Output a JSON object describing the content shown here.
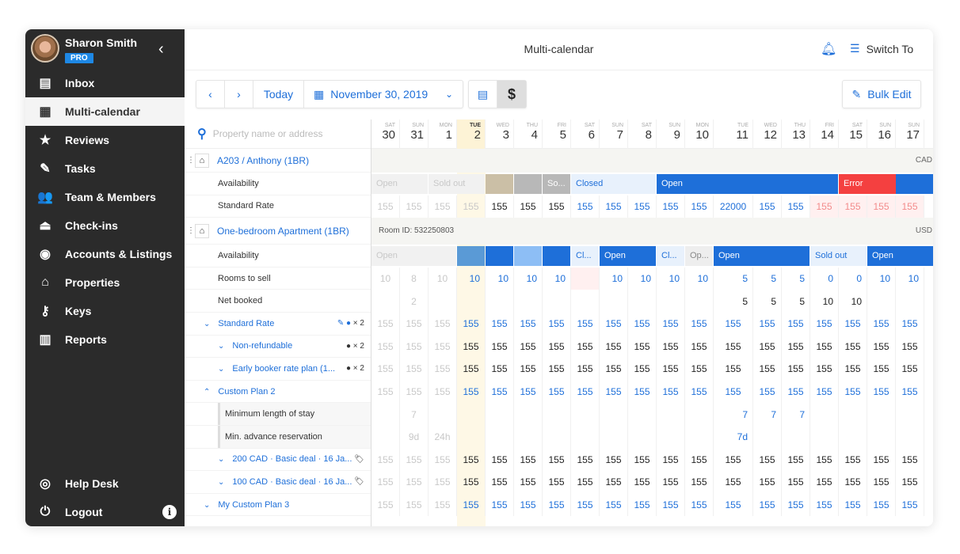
{
  "profile": {
    "name": "Sharon Smith",
    "badge": "PRO",
    "collapse_icon": "chevron-left-icon"
  },
  "sidebar": {
    "items": [
      {
        "label": "Inbox",
        "icon": "inbox-icon",
        "active": false
      },
      {
        "label": "Multi-calendar",
        "icon": "calendar-icon",
        "active": true
      },
      {
        "label": "Reviews",
        "icon": "star-icon",
        "active": false
      },
      {
        "label": "Tasks",
        "icon": "tasks-icon",
        "active": false
      },
      {
        "label": "Team & Members",
        "icon": "team-icon",
        "active": false
      },
      {
        "label": "Check-ins",
        "icon": "bell-desk-icon",
        "active": false
      },
      {
        "label": "Accounts & Listings",
        "icon": "account-icon",
        "active": false
      },
      {
        "label": "Properties",
        "icon": "home-icon",
        "active": false
      },
      {
        "label": "Keys",
        "icon": "key-icon",
        "active": false
      },
      {
        "label": "Reports",
        "icon": "reports-icon",
        "active": false
      }
    ],
    "bottom": [
      {
        "label": "Help Desk",
        "icon": "lifebuoy-icon"
      },
      {
        "label": "Logout",
        "icon": "power-icon"
      }
    ]
  },
  "header": {
    "title": "Multi-calendar",
    "switch_to": "Switch To"
  },
  "toolbar": {
    "prev": "‹",
    "next": "›",
    "today": "Today",
    "date": "November 30, 2019",
    "dropdown": "⌄",
    "view_rates": "$",
    "bulk_edit": "Bulk Edit"
  },
  "search": {
    "placeholder": "Property name or address"
  },
  "colors": {
    "accent": "#1e6fd9",
    "sidebar_bg": "#2b2b2b",
    "badge": "#1e88e5",
    "error": "#f44040",
    "open": "#1e6fd9"
  },
  "dates": [
    {
      "dow": "SAT",
      "day": "30"
    },
    {
      "dow": "SUN",
      "day": "31"
    },
    {
      "dow": "MON",
      "day": "1"
    },
    {
      "dow": "TUE",
      "day": "2",
      "today": true
    },
    {
      "dow": "WED",
      "day": "3"
    },
    {
      "dow": "THU",
      "day": "4"
    },
    {
      "dow": "FRI",
      "day": "5"
    },
    {
      "dow": "SAT",
      "day": "6"
    },
    {
      "dow": "SUN",
      "day": "7"
    },
    {
      "dow": "SAT",
      "day": "8"
    },
    {
      "dow": "SUN",
      "day": "9"
    },
    {
      "dow": "MON",
      "day": "10"
    },
    {
      "dow": "TUE",
      "day": "11"
    },
    {
      "dow": "WED",
      "day": "12"
    },
    {
      "dow": "THU",
      "day": "13"
    },
    {
      "dow": "FRI",
      "day": "14"
    },
    {
      "dow": "SAT",
      "day": "15"
    },
    {
      "dow": "SUN",
      "day": "16"
    },
    {
      "dow": "SUN",
      "day": "17"
    }
  ],
  "properties": [
    {
      "name": "A203 / Anthony (1BR)",
      "currency": "CAD",
      "rows": {
        "availability_label": "Availability",
        "rate_label": "Standard Rate",
        "availability_bars": [
          {
            "label": "Open",
            "from": 0,
            "span": 2,
            "style": "faded"
          },
          {
            "label": "Sold out",
            "from": 2,
            "span": 2,
            "style": "faded"
          },
          {
            "label": "",
            "from": 4,
            "span": 1,
            "style": "tan"
          },
          {
            "label": "",
            "from": 5,
            "span": 1,
            "style": "gray"
          },
          {
            "label": "So...",
            "from": 6,
            "span": 1,
            "style": "gray"
          },
          {
            "label": "Closed",
            "from": 7,
            "span": 3,
            "style": "closed"
          },
          {
            "label": "Open",
            "from": 10,
            "span": 6,
            "style": "open"
          },
          {
            "label": "Error",
            "from": 16,
            "span": 4,
            "style": "error"
          },
          {
            "label": "",
            "from": 20,
            "span": 1,
            "style": "open"
          }
        ],
        "rates": [
          "155",
          "155",
          "155",
          "155",
          "155",
          "155",
          "155",
          "155",
          "155",
          "155",
          "155",
          "155",
          "22000",
          "155",
          "155",
          "155",
          "155",
          "155",
          "155"
        ]
      }
    },
    {
      "name": "One-bedroom Apartment (1BR)",
      "room_id": "Room ID: 532250803",
      "currency": "USD",
      "labels": {
        "availability": "Availability",
        "rooms_to_sell": "Rooms to sell",
        "net_booked": "Net booked"
      },
      "availability_bars": [
        {
          "label": "Open",
          "from": 0,
          "span": 3,
          "style": "faded"
        },
        {
          "label": "",
          "from": 3,
          "span": 1,
          "style": "mid"
        },
        {
          "label": "",
          "from": 4,
          "span": 1,
          "style": "open"
        },
        {
          "label": "",
          "from": 5,
          "span": 1,
          "style": "light"
        },
        {
          "label": "",
          "from": 6,
          "span": 1,
          "style": "open"
        },
        {
          "label": "Cl...",
          "from": 7,
          "span": 1,
          "style": "closed"
        },
        {
          "label": "Open",
          "from": 8,
          "span": 2,
          "style": "open"
        },
        {
          "label": "Cl...",
          "from": 10,
          "span": 1,
          "style": "closed"
        },
        {
          "label": "Op...",
          "from": 11,
          "span": 1,
          "style": "gray-light"
        },
        {
          "label": "Open",
          "from": 12,
          "span": 3,
          "style": "open"
        },
        {
          "label": "Sold out",
          "from": 15,
          "span": 2,
          "style": "closed"
        },
        {
          "label": "Open",
          "from": 17,
          "span": 2,
          "style": "open"
        }
      ],
      "rooms_to_sell": [
        "10",
        "8",
        "10",
        "10",
        "10",
        "10",
        "10",
        "",
        "10",
        "10",
        "10",
        "10",
        "5",
        "5",
        "5",
        "0",
        "0",
        "10",
        "10"
      ],
      "net_booked": [
        "",
        "2",
        "",
        "",
        "",
        "",
        "",
        "",
        "",
        "",
        "",
        "",
        "5",
        "5",
        "5",
        "10",
        "10",
        "",
        ""
      ],
      "rate_plans": [
        {
          "label": "Standard Rate",
          "level": 0,
          "expanded": false,
          "badge": "✎ 👤 × 2",
          "values": "155",
          "color": "blue"
        },
        {
          "label": "Non-refundable",
          "level": 1,
          "expanded": false,
          "badge": "👤 × 2",
          "values": "155",
          "color": "dark"
        },
        {
          "label": "Early booker rate plan (1...",
          "level": 1,
          "expanded": false,
          "badge": "👤 × 2",
          "values": "155",
          "color": "dark"
        },
        {
          "label": "Custom Plan 2",
          "level": 0,
          "expanded": true,
          "badge": "",
          "values": "155",
          "color": "blue"
        }
      ],
      "restrictions": [
        {
          "label": "Minimum length of stay",
          "values": [
            "",
            "7",
            "",
            "",
            "",
            "",
            "",
            "",
            "",
            "",
            "",
            "",
            "7",
            "7",
            "7",
            "",
            "",
            "",
            ""
          ]
        },
        {
          "label": "Min. advance reservation",
          "values": [
            "",
            "9d",
            "24h",
            "",
            "",
            "",
            "",
            "",
            "",
            "",
            "",
            "",
            "7d",
            "",
            "",
            "",
            "",
            "",
            ""
          ]
        }
      ],
      "deals": [
        {
          "label": "200 CAD · Basic deal · 16 Ja...",
          "icon": "tag-icon",
          "values": "155",
          "color": "dark"
        },
        {
          "label": "100 CAD · Basic deal · 16 Ja...",
          "icon": "tag-icon",
          "values": "155",
          "color": "dark"
        }
      ],
      "last_plan": {
        "label": "My Custom Plan 3",
        "values": "155",
        "color": "blue"
      }
    }
  ]
}
